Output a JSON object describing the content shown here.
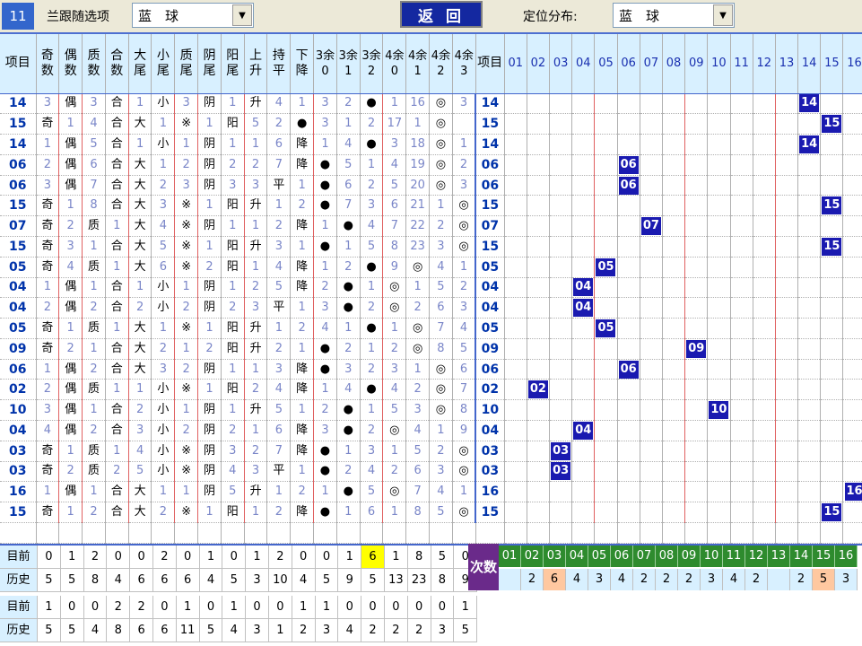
{
  "toolbar": {
    "period": "11",
    "filter_label": "兰跟随选项",
    "filter_value": "蓝　球",
    "back_label": "返 回",
    "position_label": "定位分布:",
    "position_value": "蓝　球"
  },
  "headers": {
    "item": "项目",
    "cols": [
      "奇数",
      "偶数",
      "质数",
      "合数",
      "大尾",
      "小尾",
      "质尾",
      "阴尾",
      "阳尾",
      "上升",
      "持平",
      "下降",
      "3余0",
      "3余1",
      "3余2",
      "4余0",
      "4余1",
      "4余2",
      "4余3"
    ],
    "item2": "项目",
    "nums": [
      "01",
      "02",
      "03",
      "04",
      "05",
      "06",
      "07",
      "08",
      "09",
      "10",
      "11",
      "12",
      "13",
      "14",
      "15",
      "16"
    ]
  },
  "rows": [
    {
      "item": "14",
      "cells": [
        "3",
        "偶",
        "3",
        "合",
        "1",
        "小",
        "3",
        "阴",
        "1",
        "升",
        "4",
        "1",
        "3",
        "2",
        "●",
        "1",
        "16",
        "◎",
        "3"
      ],
      "hit": 14
    },
    {
      "item": "15",
      "cells": [
        "奇",
        "1",
        "4",
        "合",
        "大",
        "1",
        "※",
        "1",
        "阳",
        "5",
        "2",
        "●",
        "3",
        "1",
        "2",
        "17",
        "1",
        "◎"
      ],
      "hit": 15
    },
    {
      "item": "14",
      "cells": [
        "1",
        "偶",
        "5",
        "合",
        "1",
        "小",
        "1",
        "阴",
        "1",
        "1",
        "6",
        "降",
        "1",
        "4",
        "●",
        "3",
        "18",
        "◎",
        "1"
      ],
      "hit": 14
    },
    {
      "item": "06",
      "cells": [
        "2",
        "偶",
        "6",
        "合",
        "大",
        "1",
        "2",
        "阴",
        "2",
        "2",
        "7",
        "降",
        "●",
        "5",
        "1",
        "4",
        "19",
        "◎",
        "2"
      ],
      "hit": 6
    },
    {
      "item": "06",
      "cells": [
        "3",
        "偶",
        "7",
        "合",
        "大",
        "2",
        "3",
        "阴",
        "3",
        "3",
        "平",
        "1",
        "●",
        "6",
        "2",
        "5",
        "20",
        "◎",
        "3"
      ],
      "hit": 6
    },
    {
      "item": "15",
      "cells": [
        "奇",
        "1",
        "8",
        "合",
        "大",
        "3",
        "※",
        "1",
        "阳",
        "升",
        "1",
        "2",
        "●",
        "7",
        "3",
        "6",
        "21",
        "1",
        "◎"
      ],
      "hit": 15
    },
    {
      "item": "07",
      "cells": [
        "奇",
        "2",
        "质",
        "1",
        "大",
        "4",
        "※",
        "阴",
        "1",
        "1",
        "2",
        "降",
        "1",
        "●",
        "4",
        "7",
        "22",
        "2",
        "◎"
      ],
      "hit": 7
    },
    {
      "item": "15",
      "cells": [
        "奇",
        "3",
        "1",
        "合",
        "大",
        "5",
        "※",
        "1",
        "阳",
        "升",
        "3",
        "1",
        "●",
        "1",
        "5",
        "8",
        "23",
        "3",
        "◎"
      ],
      "hit": 15
    },
    {
      "item": "05",
      "cells": [
        "奇",
        "4",
        "质",
        "1",
        "大",
        "6",
        "※",
        "2",
        "阳",
        "1",
        "4",
        "降",
        "1",
        "2",
        "●",
        "9",
        "◎",
        "4",
        "1"
      ],
      "hit": 5
    },
    {
      "item": "04",
      "cells": [
        "1",
        "偶",
        "1",
        "合",
        "1",
        "小",
        "1",
        "阴",
        "1",
        "2",
        "5",
        "降",
        "2",
        "●",
        "1",
        "◎",
        "1",
        "5",
        "2"
      ],
      "hit": 4
    },
    {
      "item": "04",
      "cells": [
        "2",
        "偶",
        "2",
        "合",
        "2",
        "小",
        "2",
        "阴",
        "2",
        "3",
        "平",
        "1",
        "3",
        "●",
        "2",
        "◎",
        "2",
        "6",
        "3"
      ],
      "hit": 4
    },
    {
      "item": "05",
      "cells": [
        "奇",
        "1",
        "质",
        "1",
        "大",
        "1",
        "※",
        "1",
        "阳",
        "升",
        "1",
        "2",
        "4",
        "1",
        "●",
        "1",
        "◎",
        "7",
        "4"
      ],
      "hit": 5
    },
    {
      "item": "09",
      "cells": [
        "奇",
        "2",
        "1",
        "合",
        "大",
        "2",
        "1",
        "2",
        "阳",
        "升",
        "2",
        "1",
        "●",
        "2",
        "1",
        "2",
        "◎",
        "8",
        "5"
      ],
      "hit": 9
    },
    {
      "item": "06",
      "cells": [
        "1",
        "偶",
        "2",
        "合",
        "大",
        "3",
        "2",
        "阴",
        "1",
        "1",
        "3",
        "降",
        "●",
        "3",
        "2",
        "3",
        "1",
        "◎",
        "6"
      ],
      "hit": 6
    },
    {
      "item": "02",
      "cells": [
        "2",
        "偶",
        "质",
        "1",
        "1",
        "小",
        "※",
        "1",
        "阳",
        "2",
        "4",
        "降",
        "1",
        "4",
        "●",
        "4",
        "2",
        "◎",
        "7"
      ],
      "hit": 2
    },
    {
      "item": "10",
      "cells": [
        "3",
        "偶",
        "1",
        "合",
        "2",
        "小",
        "1",
        "阴",
        "1",
        "升",
        "5",
        "1",
        "2",
        "●",
        "1",
        "5",
        "3",
        "◎",
        "8"
      ],
      "hit": 10
    },
    {
      "item": "04",
      "cells": [
        "4",
        "偶",
        "2",
        "合",
        "3",
        "小",
        "2",
        "阴",
        "2",
        "1",
        "6",
        "降",
        "3",
        "●",
        "2",
        "◎",
        "4",
        "1",
        "9"
      ],
      "hit": 4
    },
    {
      "item": "03",
      "cells": [
        "奇",
        "1",
        "质",
        "1",
        "4",
        "小",
        "※",
        "阴",
        "3",
        "2",
        "7",
        "降",
        "●",
        "1",
        "3",
        "1",
        "5",
        "2",
        "◎"
      ],
      "hit": 3
    },
    {
      "item": "03",
      "cells": [
        "奇",
        "2",
        "质",
        "2",
        "5",
        "小",
        "※",
        "阴",
        "4",
        "3",
        "平",
        "1",
        "●",
        "2",
        "4",
        "2",
        "6",
        "3",
        "◎"
      ],
      "hit": 3
    },
    {
      "item": "16",
      "cells": [
        "1",
        "偶",
        "1",
        "合",
        "大",
        "1",
        "1",
        "阴",
        "5",
        "升",
        "1",
        "2",
        "1",
        "●",
        "5",
        "◎",
        "7",
        "4",
        "1"
      ],
      "hit": 16
    },
    {
      "item": "15",
      "cells": [
        "奇",
        "1",
        "2",
        "合",
        "大",
        "2",
        "※",
        "1",
        "阳",
        "1",
        "2",
        "降",
        "●",
        "1",
        "6",
        "1",
        "8",
        "5",
        "◎"
      ],
      "hit": 15
    }
  ],
  "summary": {
    "current_label": "目前",
    "history_label": "历史",
    "current": [
      "0",
      "1",
      "2",
      "0",
      "0",
      "2",
      "0",
      "1",
      "0",
      "1",
      "2",
      "0",
      "0",
      "1",
      "6",
      "1",
      "8",
      "5",
      "0"
    ],
    "history": [
      "5",
      "5",
      "8",
      "4",
      "6",
      "6",
      "6",
      "4",
      "5",
      "3",
      "10",
      "4",
      "5",
      "9",
      "5",
      "13",
      "23",
      "8",
      "9"
    ],
    "highlight_index": 14,
    "cishu_label": "次数",
    "num_labels": [
      "01",
      "02",
      "03",
      "04",
      "05",
      "06",
      "07",
      "08",
      "09",
      "10",
      "11",
      "12",
      "13",
      "14",
      "15",
      "16"
    ],
    "num_counts": [
      "",
      "2",
      "6",
      "4",
      "3",
      "4",
      "2",
      "2",
      "2",
      "3",
      "4",
      "2",
      "",
      "2",
      "5",
      "3"
    ],
    "num_highlight": [
      2,
      14
    ]
  },
  "summary2": {
    "current_label": "目前",
    "history_label": "历史",
    "current": [
      "1",
      "0",
      "0",
      "2",
      "2",
      "0",
      "1",
      "0",
      "1",
      "0",
      "0",
      "1",
      "1",
      "0",
      "0",
      "0",
      "0",
      "0",
      "1"
    ],
    "history": [
      "5",
      "5",
      "4",
      "8",
      "6",
      "6",
      "11",
      "5",
      "4",
      "3",
      "1",
      "2",
      "3",
      "4",
      "2",
      "2",
      "2",
      "3",
      "5"
    ]
  },
  "colors": {
    "hit_bg": "#1a1ab0",
    "header_bg": "#d8f0ff",
    "cishu_bg": "#6a2a8a",
    "num_header_bg": "#2e8b2e"
  }
}
